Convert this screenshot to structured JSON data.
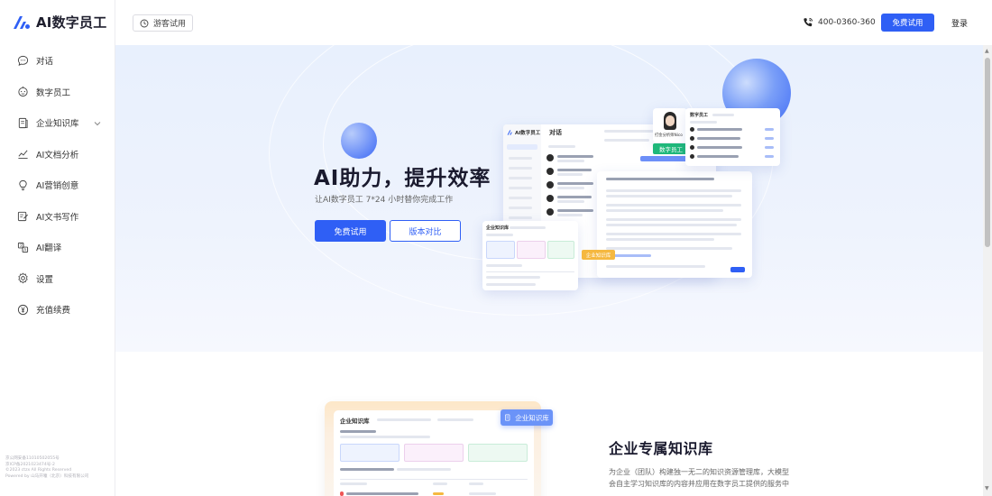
{
  "app": {
    "name": "AI数字员工"
  },
  "sidebar": {
    "items": [
      {
        "label": "对话",
        "icon": "chat-icon"
      },
      {
        "label": "数字员工",
        "icon": "robot-icon"
      },
      {
        "label": "企业知识库",
        "icon": "document-icon",
        "has_submenu": true
      },
      {
        "label": "AI文档分析",
        "icon": "chart-icon"
      },
      {
        "label": "AI营销创意",
        "icon": "lightbulb-icon"
      },
      {
        "label": "AI文书写作",
        "icon": "edit-icon"
      },
      {
        "label": "AI翻译",
        "icon": "translate-icon"
      },
      {
        "label": "设置",
        "icon": "gear-icon"
      },
      {
        "label": "充值续费",
        "icon": "yuan-icon"
      }
    ],
    "footer": {
      "line1": "京公网安备11010502055号",
      "line2": "京ICP备2021023474号-2",
      "line3": "©2023 ctzx All Rights Reserved",
      "line4": "Powered by 山马开曈（北京）科技有限公司"
    }
  },
  "header": {
    "guest_label": "游客试用",
    "phone": "400-0360-360",
    "free_trial_label": "免费试用",
    "login_label": "登录"
  },
  "hero": {
    "title": "AI助力，提升效率",
    "subtitle": "让AI数字员工 7*24 小时替你完成工作",
    "primary_button": "免费试用",
    "secondary_button": "版本对比"
  },
  "preview": {
    "app_title": "AI数字员工",
    "chat_tab": "对话",
    "digital_employee_tag": "数字员工",
    "knowledge_tag": "企业知识库",
    "kb_panel_title": "企业知识库",
    "employee_panel_title": "数字员工",
    "employee_name": "打金分析师Nico"
  },
  "feature": {
    "badge": "企业知识库",
    "title": "企业专属知识库",
    "description": "为企业（团队）构建独一无二的知识资源管理库，大模型会自主学习知识库的内容并应用在数字员工提供的服务中"
  },
  "colors": {
    "primary": "#2f5ff5",
    "hero_bg": "#e8f0fd",
    "green_tag": "#1fb87a",
    "orange_tag": "#f5b840"
  }
}
